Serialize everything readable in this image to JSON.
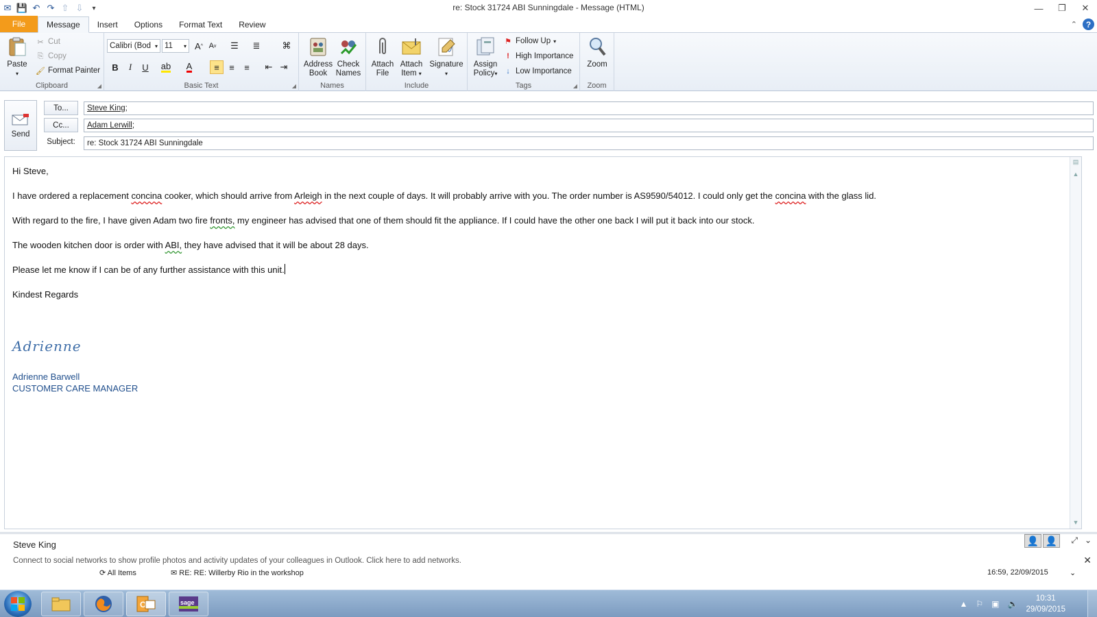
{
  "window": {
    "title": "re: Stock 31724 ABI Sunningdale  -  Message (HTML)"
  },
  "qat": {
    "icons": [
      "outlook-icon",
      "save-icon",
      "undo-icon",
      "redo-icon",
      "up-arrow-icon",
      "down-arrow-icon",
      "customize-icon"
    ]
  },
  "tabs": [
    {
      "label": "File"
    },
    {
      "label": "Message"
    },
    {
      "label": "Insert"
    },
    {
      "label": "Options"
    },
    {
      "label": "Format Text"
    },
    {
      "label": "Review"
    }
  ],
  "ribbon": {
    "clipboard": {
      "label": "Clipboard",
      "paste": "Paste",
      "cut": "Cut",
      "copy": "Copy",
      "format_painter": "Format Painter"
    },
    "basic_text": {
      "label": "Basic Text",
      "font_name": "Calibri (Bod",
      "font_size": "11",
      "bold": "B",
      "italic": "I",
      "underline": "U"
    },
    "names": {
      "label": "Names",
      "address_book_1": "Address",
      "address_book_2": "Book",
      "check_names_1": "Check",
      "check_names_2": "Names"
    },
    "include": {
      "label": "Include",
      "attach_file_1": "Attach",
      "attach_file_2": "File",
      "attach_item_1": "Attach",
      "attach_item_2": "Item",
      "signature": "Signature"
    },
    "tags": {
      "label": "Tags",
      "assign_policy_1": "Assign",
      "assign_policy_2": "Policy",
      "follow_up": "Follow Up",
      "high_importance": "High Importance",
      "low_importance": "Low Importance"
    },
    "zoom": {
      "label": "Zoom",
      "zoom": "Zoom"
    }
  },
  "header": {
    "send": "Send",
    "to_button": "To...",
    "cc_button": "Cc...",
    "subject_label": "Subject:",
    "to_value": "Steve King",
    "cc_value": "Adam Lerwill",
    "subject_value": "re: Stock 31724 ABI Sunningdale"
  },
  "body": {
    "greeting": "Hi Steve,",
    "p1_a": "I have ordered a replacement ",
    "p1_w1": "concina",
    "p1_b": " cooker, which should arrive from ",
    "p1_w2": "Arleigh",
    "p1_c": " in the next couple of days.  It will probably arrive with you.  The order number is AS9590/54012.  I could only get the ",
    "p1_w3": "concina",
    "p1_d": " with the glass lid.",
    "p2_a": "With regard to the fire, I have given Adam two fire ",
    "p2_w1": "fronts,",
    "p2_b": " my engineer has advised that one of them should fit the appliance.  If I could have the other one back I will put it back into our stock.",
    "p3_a": "The wooden kitchen door is order with ",
    "p3_w1": "ABI,",
    "p3_b": " they have advised that it will be about 28 days.",
    "p4": "Please let me know if I can be of any further assistance with this unit.",
    "closing": "Kindest Regards",
    "signature_script": "Adrienne",
    "signature_name": "Adrienne Barwell",
    "signature_title": "CUSTOMER CARE MANAGER"
  },
  "people_pane": {
    "name": "Steve King",
    "message": "Connect to social networks to show profile photos and activity updates of your colleagues in Outlook. Click here to add networks.",
    "filter": "All Items",
    "item_subject": "RE: RE: Willerby Rio in the workshop",
    "item_date": "16:59, 22/09/2015"
  },
  "taskbar": {
    "apps": [
      "explorer-icon",
      "firefox-icon",
      "outlook-icon",
      "sage-icon"
    ],
    "time": "10:31",
    "date": "29/09/2015"
  },
  "colors": {
    "file_tab": "#f39b1b",
    "signature_blue": "#1f4e8c",
    "spell_red": "#dd2222",
    "grammar_green": "#3a9a3a"
  }
}
